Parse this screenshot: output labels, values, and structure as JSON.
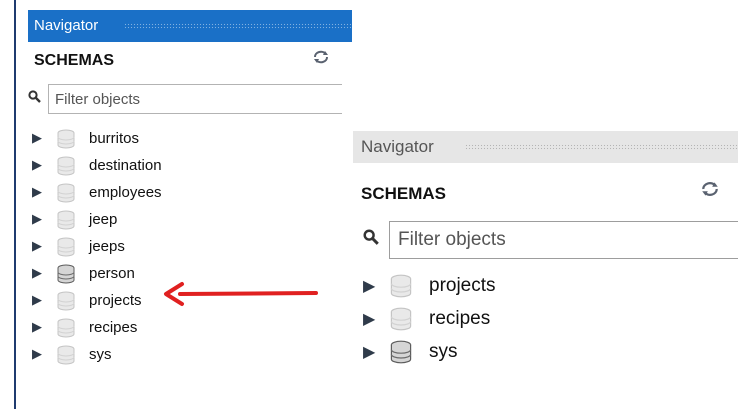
{
  "panel_left": {
    "title": "Navigator",
    "section": "SCHEMAS",
    "refresh_icon": "refresh-icon",
    "search": {
      "placeholder": "Filter objects",
      "value": ""
    },
    "schemas": [
      {
        "name": "burritos",
        "variant": "light"
      },
      {
        "name": "destination",
        "variant": "light"
      },
      {
        "name": "employees",
        "variant": "light"
      },
      {
        "name": "jeep",
        "variant": "light"
      },
      {
        "name": "jeeps",
        "variant": "light"
      },
      {
        "name": "person",
        "variant": "dark"
      },
      {
        "name": "projects",
        "variant": "light"
      },
      {
        "name": "recipes",
        "variant": "light"
      },
      {
        "name": "sys",
        "variant": "light"
      }
    ]
  },
  "panel_right": {
    "title": "Navigator",
    "section": "SCHEMAS",
    "refresh_icon": "refresh-icon",
    "search": {
      "placeholder": "Filter objects",
      "value": ""
    },
    "schemas": [
      {
        "name": "projects",
        "variant": "light"
      },
      {
        "name": "recipes",
        "variant": "light"
      },
      {
        "name": "sys",
        "variant": "dark"
      }
    ]
  },
  "annotation": {
    "icon": "red-arrow-icon",
    "color": "#e02020",
    "points_to": "projects"
  },
  "colors": {
    "header_active": "#1a70c7",
    "header_inactive": "#e6e6e6",
    "arrow": "#e02020"
  }
}
